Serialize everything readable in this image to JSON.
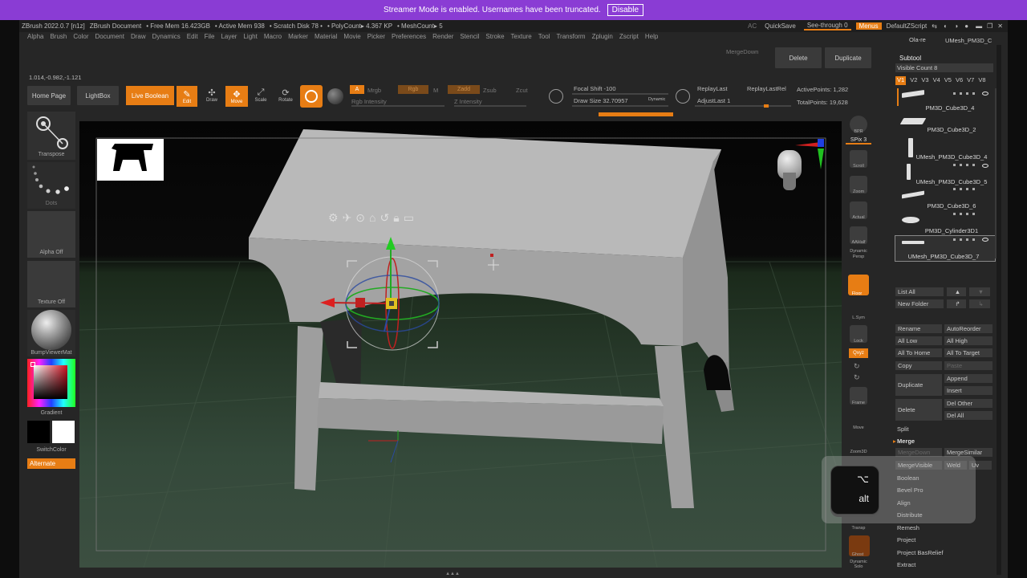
{
  "banner": {
    "message": "Streamer Mode is enabled. Usernames have been truncated.",
    "disable_label": "Disable"
  },
  "titlebar": {
    "app": "ZBrush 2022.0.7 [n1z]",
    "doc": "ZBrush Document",
    "free_mem": "• Free Mem 16.423GB",
    "active_mem": "• Active Mem 938",
    "scratch": "• Scratch Disk 78 •",
    "polycount": "• PolyCount▸ 4.367 KP",
    "meshcount": "• MeshCount▸ 5",
    "ac": "AC",
    "quicksave": "QuickSave",
    "seethrough": "See-through",
    "seethrough_val": "0",
    "menus": "Menus",
    "script": "DefaultZScript"
  },
  "menubar": [
    "Alpha",
    "Brush",
    "Color",
    "Document",
    "Draw",
    "Dynamics",
    "Edit",
    "File",
    "Layer",
    "Light",
    "Macro",
    "Marker",
    "Material",
    "Movie",
    "Picker",
    "Preferences",
    "Render",
    "Stencil",
    "Stroke",
    "Texture",
    "Tool",
    "Transform",
    "Zplugin",
    "Zscript",
    "Help"
  ],
  "toolbar": {
    "coords": "1.014,-0.982,-1.121",
    "mergedown": "MergeDown",
    "delete": "Delete",
    "duplicate": "Duplicate",
    "home_page": "Home Page",
    "lightbox": "LightBox",
    "live_boolean": "Live Boolean",
    "edit": "Edit",
    "draw": "Draw",
    "move": "Move",
    "scale": "Scale",
    "rotate": "Rotate",
    "a": "A",
    "mrgb": "Mrgb",
    "rgb": "Rgb",
    "m": "M",
    "zadd": "Zadd",
    "zsub": "Zsub",
    "zcut": "Zcut",
    "rgb_intensity": "Rgb Intensity",
    "z_intensity": "Z Intensity",
    "focal_shift": "Focal Shift -100",
    "draw_size": "Draw Size 32.70957",
    "dynamic": "Dynamic",
    "replaylast": "ReplayLast",
    "replaylastrel": "ReplayLastRel",
    "adjustlast": "AdjustLast 1",
    "active_points": "ActivePoints: 1,282",
    "total_points": "TotalPoints: 19,628"
  },
  "left_panel": {
    "transpose": "Transpose",
    "dots": "Dots",
    "alpha_off": "Alpha Off",
    "texture_off": "Texture Off",
    "material": "BumpViewerMat",
    "gradient": "Gradient",
    "switchcolor": "SwitchColor",
    "alternate": "Alternate"
  },
  "right_icons": [
    "BPR",
    "SPix 3",
    "Scroll",
    "Zoom",
    "Actual",
    "AAHalf",
    "Dynamic Persp",
    "Floor",
    "L.Sym",
    "Lock",
    "Qxyz",
    "Frame",
    "Move",
    "Zoom3D",
    "Transp",
    "Ghost",
    "Dynamic Solo"
  ],
  "subtool": {
    "title": "Subtool",
    "visible_count": "Visible Count 8",
    "versions": [
      "V1",
      "V2",
      "V3",
      "V4",
      "V5",
      "V6",
      "V7",
      "V8"
    ],
    "items": [
      {
        "name": "PM3D_Cube3D_4"
      },
      {
        "name": "PM3D_Cube3D_2"
      },
      {
        "name": "UMesh_PM3D_Cube3D_4"
      },
      {
        "name": "UMesh_PM3D_Cube3D_5"
      },
      {
        "name": "PM3D_Cube3D_6"
      },
      {
        "name": "PM3D_Cylinder3D1"
      },
      {
        "name": "UMesh_PM3D_Cube3D_7"
      }
    ],
    "list_all": "List All",
    "new_folder": "New Folder",
    "rename": "Rename",
    "autoreorder": "AutoReorder",
    "all_low": "All Low",
    "all_high": "All High",
    "all_to_home": "All To Home",
    "all_to_target": "All To Target",
    "copy": "Copy",
    "paste": "Paste",
    "duplicate": "Duplicate",
    "append": "Append",
    "insert": "Insert",
    "delete": "Delete",
    "del_other": "Del Other",
    "del_all": "Del All",
    "split": "Split",
    "merge": "Merge",
    "mergedown": "MergeDown",
    "mergesimilar": "MergeSimilar",
    "mergevisible": "MergeVisible",
    "weld": "Weld",
    "uv": "Uv",
    "boolean": "Boolean",
    "bevel_pro": "Bevel Pro",
    "align": "Align",
    "distribute": "Distribute",
    "remesh": "Remesh",
    "project": "Project",
    "project_basrelief": "Project BasRelief",
    "extract": "Extract"
  },
  "header_right": {
    "top_label": "Ola-re",
    "mesh_label": "UMesh_PM3D_C"
  },
  "key_overlay": {
    "symbol": "⌥",
    "label": "alt"
  },
  "colors": {
    "accent": "#e77d14",
    "banner": "#8a3cd4",
    "bg": "#262626"
  }
}
